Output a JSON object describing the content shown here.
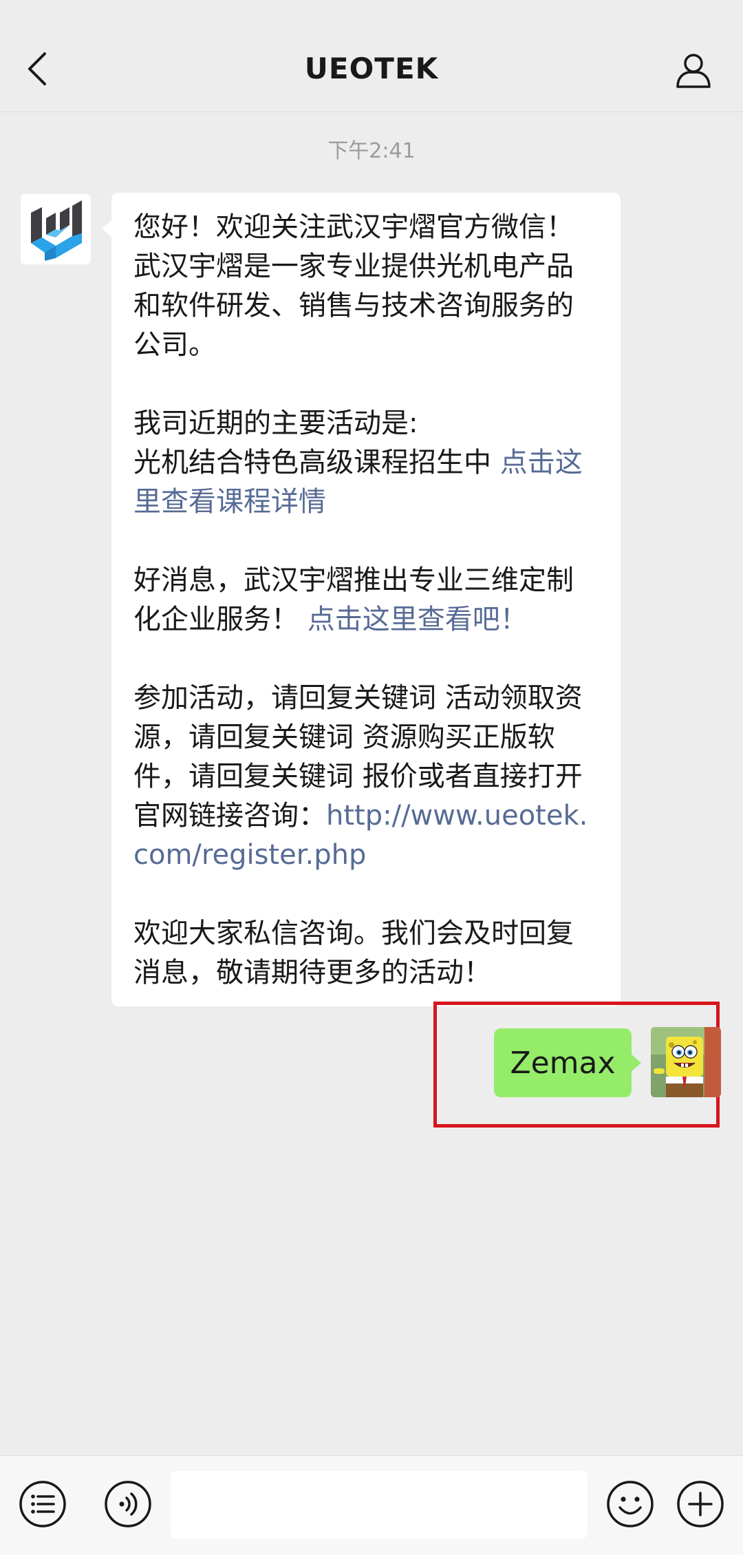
{
  "header": {
    "title": "UEOTEK",
    "back_icon": "chevron-left-icon",
    "profile_icon": "person-icon"
  },
  "conversation": {
    "timestamp": "下午2:41",
    "incoming": {
      "p1": "您好！欢迎关注武汉宇熠官方微信！武汉宇熠是一家专业提供光机电产品和软件研发、销售与技术咨询服务的公司。",
      "p2_title": "我司近期的主要活动是:",
      "p2_text": "光机结合特色高级课程招生中 ",
      "p2_link": "点击这里查看课程详情",
      "p3_text": "好消息，武汉宇熠推出专业三维定制化企业服务！ ",
      "p3_link": "点击这里查看吧！",
      "p4_text": "参加活动，请回复关键词 活动领取资源，请回复关键词 资源购买正版软件，请回复关键词 报价或者直接打开官网链接咨询：",
      "p4_link": "http://www.ueotek.com/register.php",
      "p5": "欢迎大家私信咨询。我们会及时回复消息，敬请期待更多的活动！"
    },
    "outgoing": {
      "text": "Zemax"
    }
  },
  "input_bar": {
    "placeholder": "",
    "value": ""
  },
  "colors": {
    "background": "#ededed",
    "incoming_bubble": "#ffffff",
    "outgoing_bubble": "#95ec69",
    "link": "#576b95",
    "highlight": "#d7151c",
    "logo_dark": "#3d3f42",
    "logo_blue": "#2aa3e8"
  }
}
